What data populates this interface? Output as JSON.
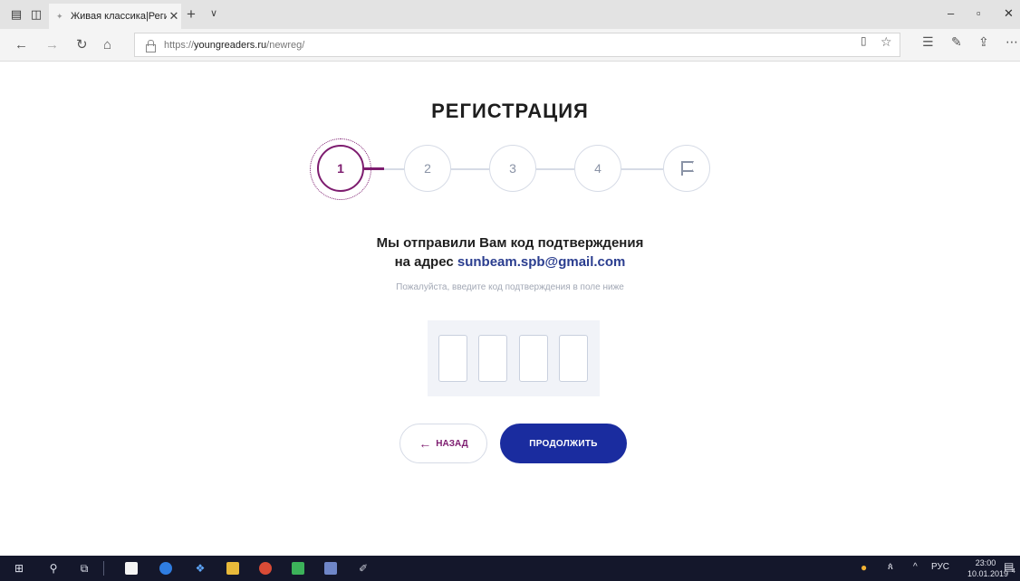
{
  "browser": {
    "tab_title": "Живая классика|Регист",
    "url_scheme": "https://",
    "url_host": "youngreaders.ru",
    "url_path": "/newreg/"
  },
  "page": {
    "title": "РЕГИСТРАЦИЯ",
    "steps": [
      "1",
      "2",
      "3",
      "4"
    ],
    "active_step": 1,
    "message_line1": "Мы отправили Вам код подтверждения",
    "message_line2_prefix": "на адрес ",
    "email": "sunbeam.spb@gmail.com",
    "hint": "Пожалуйста, введите код подтверждения в поле ниже",
    "code_length": 4,
    "back_label": "НАЗАД",
    "next_label": "ПРОДОЛЖИТЬ"
  },
  "taskbar": {
    "language": "РУС",
    "time": "23:00",
    "date": "10.01.2019",
    "notification_count": "4"
  },
  "colors": {
    "accent": "#7d1c6f",
    "primary_button": "#1a2c9f",
    "email_link": "#2a3d8f",
    "taskbar": "#14172b"
  }
}
